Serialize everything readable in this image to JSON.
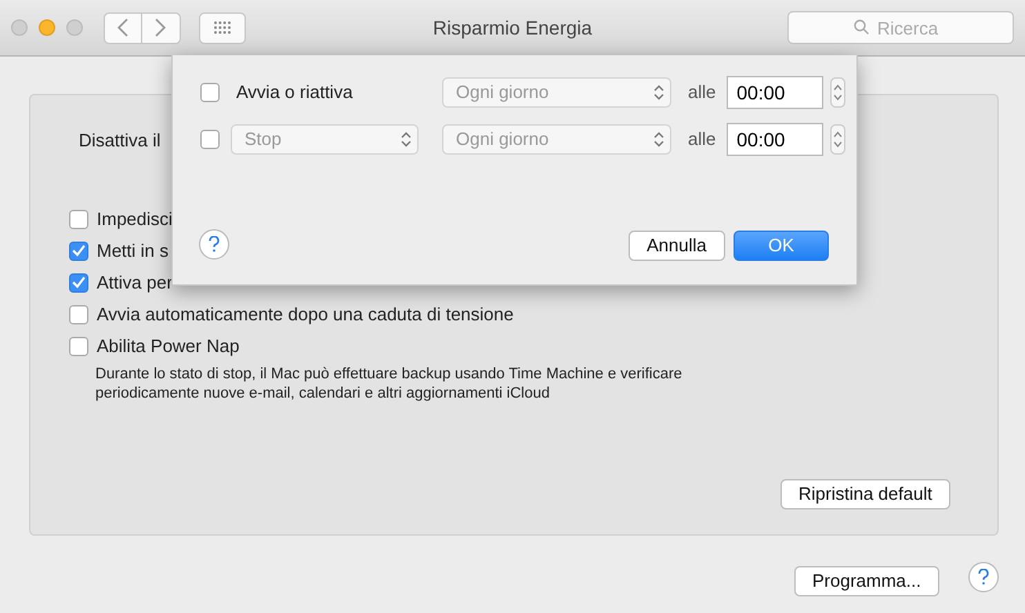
{
  "window": {
    "title": "Risparmio Energia",
    "search": {
      "placeholder": "Ricerca"
    }
  },
  "panel": {
    "heading": "Disattiva il",
    "options": [
      {
        "label": "Impedisci",
        "checked": false
      },
      {
        "label": "Metti in s",
        "checked": true
      },
      {
        "label": "Attiva per",
        "checked": true
      },
      {
        "label": "Avvia automaticamente dopo una caduta di tensione",
        "checked": false
      },
      {
        "label": "Abilita Power Nap",
        "checked": false
      }
    ],
    "description": "Durante lo stato di stop, il Mac può effettuare backup usando Time Machine e verificare periodicamente nuove e-mail, calendari e altri aggiornamenti iCloud",
    "reset_button": "Ripristina default"
  },
  "schedule_button": "Programma...",
  "sheet": {
    "rows": [
      {
        "kind": "label",
        "checked": false,
        "event": "Avvia o riattiva",
        "day": "Ogni giorno",
        "at": "alle",
        "time": "00:00"
      },
      {
        "kind": "select",
        "checked": false,
        "event": "Stop",
        "day": "Ogni giorno",
        "at": "alle",
        "time": "00:00"
      }
    ],
    "buttons": [
      {
        "label": "Annulla",
        "default": false
      },
      {
        "label": "OK",
        "default": true
      }
    ]
  }
}
